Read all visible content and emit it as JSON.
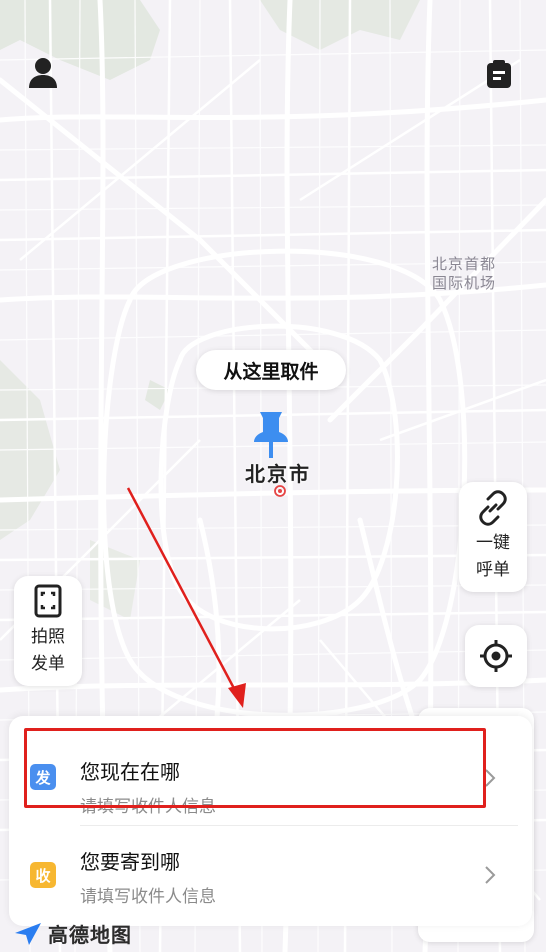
{
  "map": {
    "city": "北京市",
    "airport_label_line1": "北京首都",
    "airport_label_line2": "国际机场"
  },
  "pickup_bubble": "从这里取件",
  "one_key_call": {
    "line1": "一键",
    "line2": "呼单"
  },
  "photo_order": {
    "line1": "拍照",
    "line2": "发单"
  },
  "sender": {
    "badge": "发",
    "title": "您现在在哪",
    "subtitle": "请填写收件人信息"
  },
  "receiver": {
    "badge": "收",
    "title": "您要寄到哪",
    "subtitle": "请填写收件人信息"
  },
  "brand": {
    "name": "高德地图"
  },
  "colors": {
    "send_badge": "#4a8fef",
    "receive_badge": "#f7b731",
    "highlight": "#e0201d",
    "pin": "#3d8ef0"
  },
  "icons": {
    "profile": "user-icon",
    "orders": "clipboard-icon",
    "one_key_call": "link-icon",
    "photo_order": "scan-icon",
    "locate": "crosshair-icon"
  }
}
